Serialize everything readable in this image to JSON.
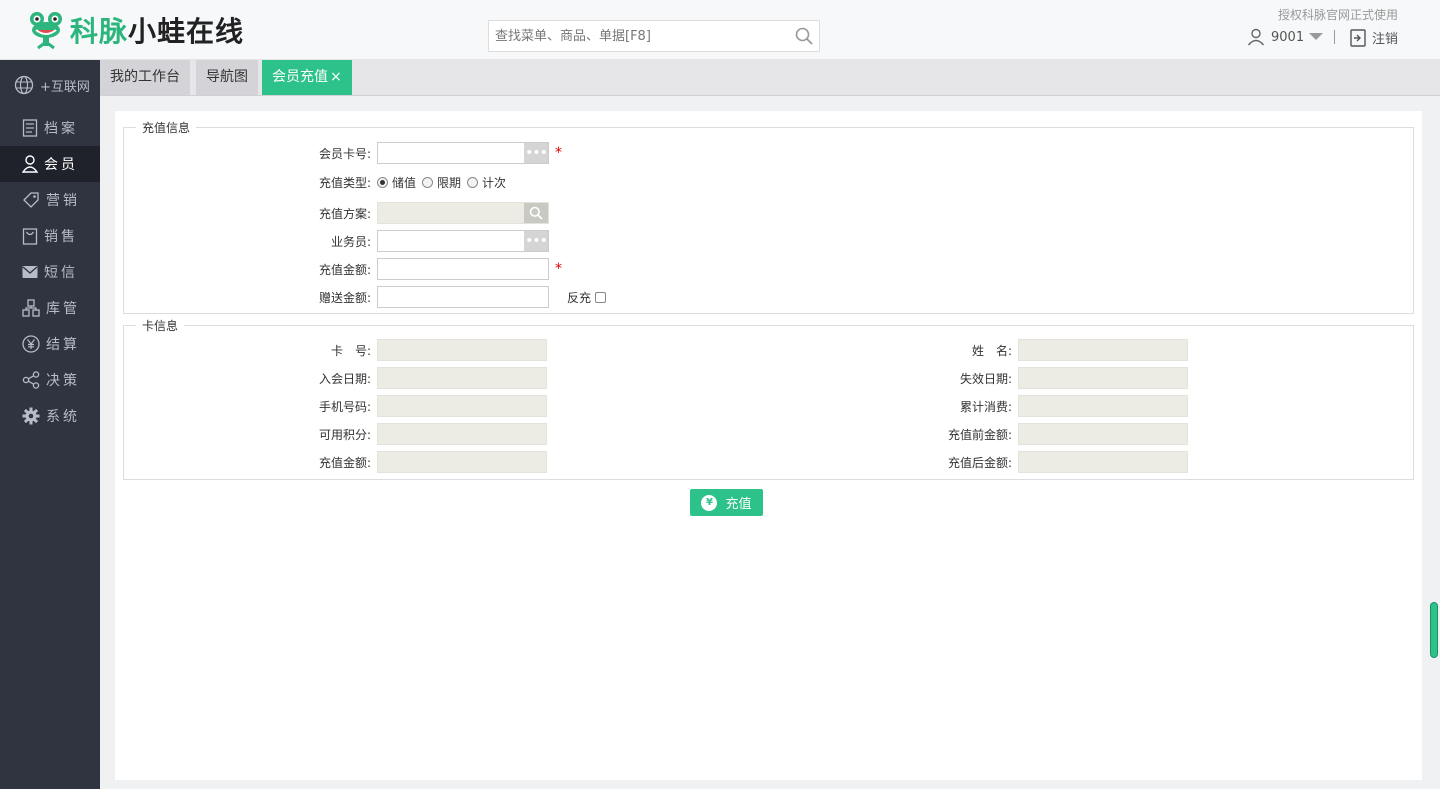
{
  "header": {
    "logo_green": "科脉",
    "logo_dark": "小蛙在线",
    "search_placeholder": "查找菜单、商品、单据[F8]",
    "auth_text": "授权科脉官网正式使用",
    "user": "9001",
    "logout": "注销"
  },
  "sidebar": {
    "items": [
      {
        "label": "+互联网",
        "icon": "globe-icon"
      },
      {
        "label": "档案",
        "icon": "document-icon"
      },
      {
        "label": "会员",
        "icon": "user-icon"
      },
      {
        "label": "营销",
        "icon": "tag-icon"
      },
      {
        "label": "销售",
        "icon": "bag-icon"
      },
      {
        "label": "短信",
        "icon": "envelope-icon"
      },
      {
        "label": "库管",
        "icon": "boxes-icon"
      },
      {
        "label": "结算",
        "icon": "yen-icon"
      },
      {
        "label": "决策",
        "icon": "share-icon"
      },
      {
        "label": "系统",
        "icon": "gear-icon"
      }
    ],
    "active_index": 2
  },
  "tabs": [
    {
      "label": "我的工作台"
    },
    {
      "label": "导航图"
    },
    {
      "label": "会员充值",
      "close": "×"
    }
  ],
  "recharge_info": {
    "legend": "充值信息",
    "card_no_label": "会员卡号:",
    "type_label": "充值类型:",
    "type_options": [
      "储值",
      "限期",
      "计次"
    ],
    "type_selected": 0,
    "plan_label": "充值方案:",
    "salesman_label": "业务员:",
    "amount_label": "充值金额:",
    "gift_label": "赠送金额:",
    "reverse_label": "反充",
    "required_mark": "*"
  },
  "card_info": {
    "legend": "卡信息",
    "left": [
      "卡　号:",
      "入会日期:",
      "手机号码:",
      "可用积分:",
      "充值金额:"
    ],
    "right": [
      "姓　名:",
      "失效日期:",
      "累计消费:",
      "充值前金额:",
      "充值后金额:"
    ]
  },
  "submit_label": "充值",
  "submit_icon_text": "¥"
}
